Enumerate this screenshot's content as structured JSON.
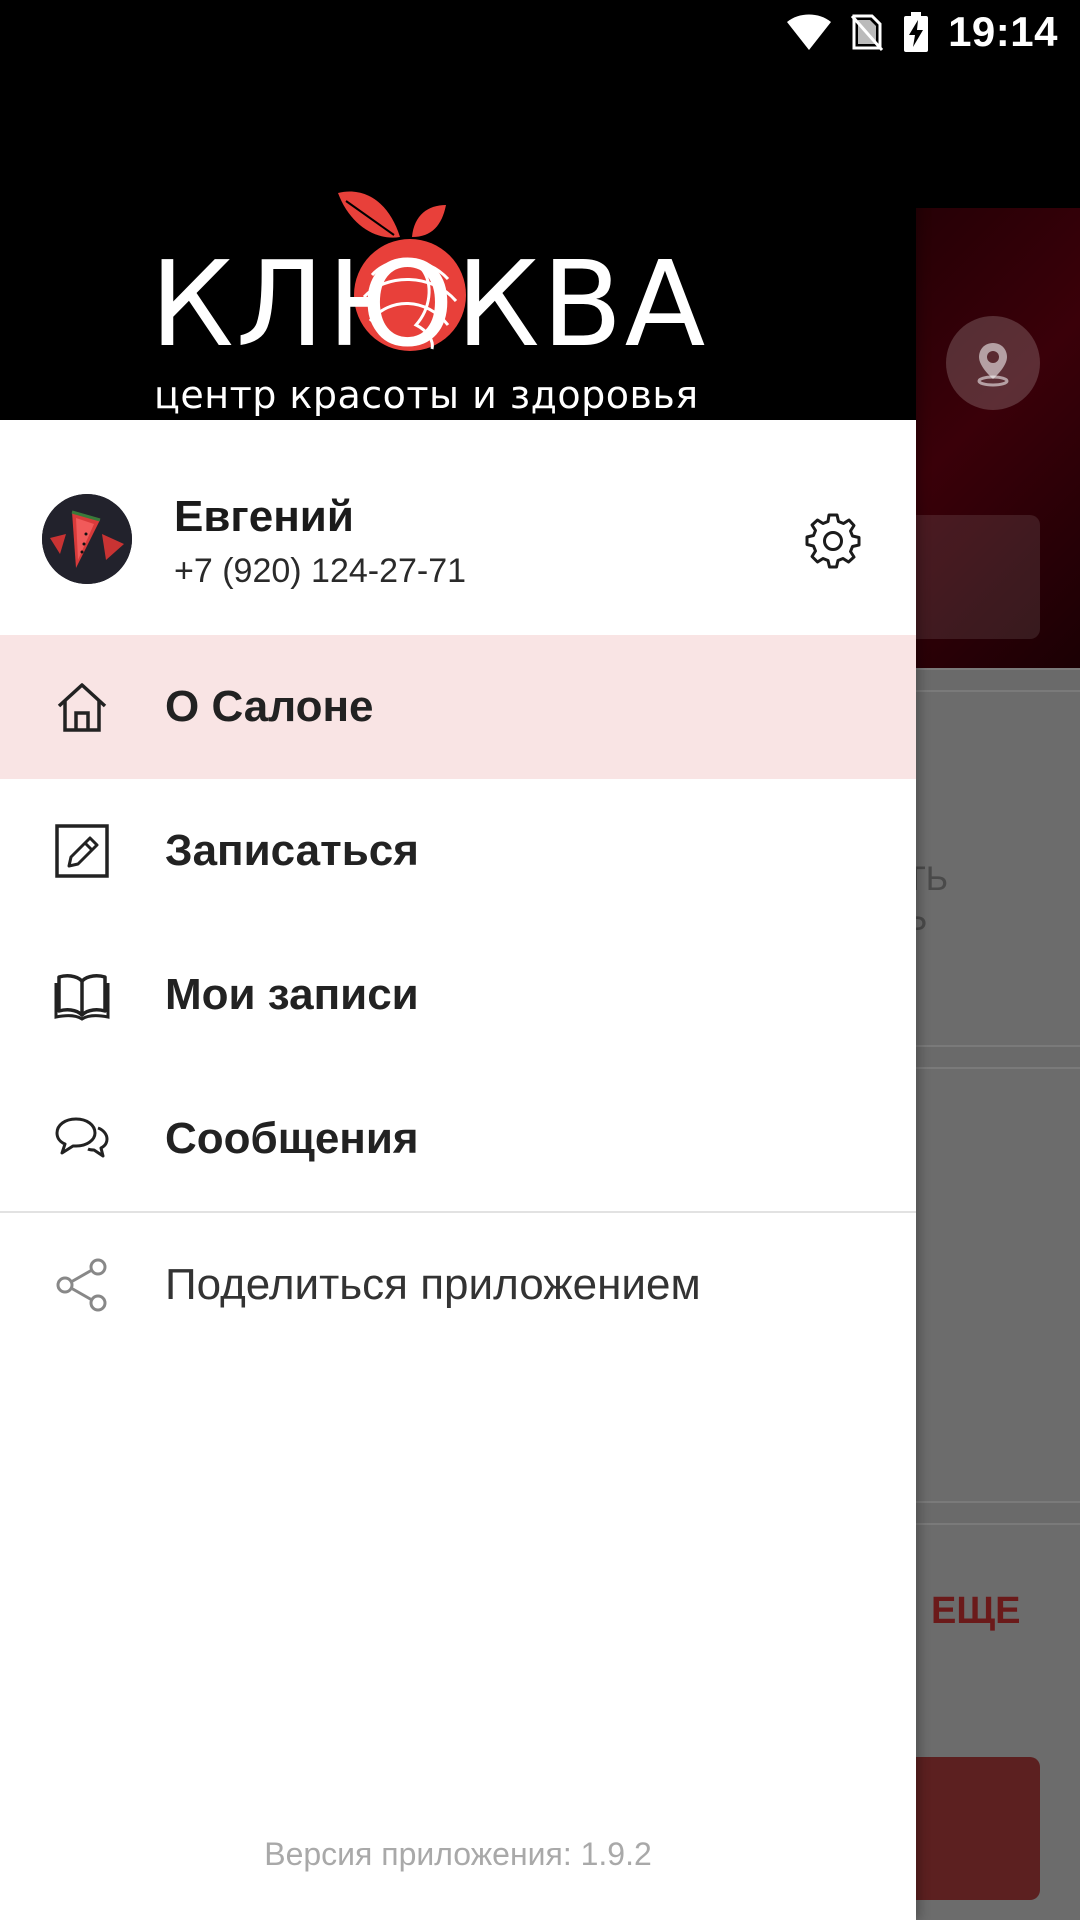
{
  "status_bar": {
    "time": "19:14",
    "icons": [
      "wifi-icon",
      "no-sim-icon",
      "battery-charging-icon"
    ]
  },
  "logo": {
    "wordmark": "КЛЮКВА",
    "tagline": "центр красоты и здоровья",
    "colors": {
      "brand_red": "#e8403a",
      "text": "#ffffff",
      "background": "#000000"
    }
  },
  "profile": {
    "name": "Евгений",
    "phone": "+7 (920) 124-27-71",
    "settings_icon": "gear-icon"
  },
  "menu": {
    "items": [
      {
        "label": "О Салоне",
        "icon": "home-icon",
        "active": true
      },
      {
        "label": "Записаться",
        "icon": "edit-icon",
        "active": false
      },
      {
        "label": "Мои записи",
        "icon": "book-icon",
        "active": false
      },
      {
        "label": "Сообщения",
        "icon": "chat-icon",
        "active": false
      }
    ],
    "secondary": [
      {
        "label": "Поделиться приложением",
        "icon": "share-icon"
      }
    ]
  },
  "footer": {
    "version": "Версия приложения: 1.9.2"
  },
  "background_app": {
    "partial_text_1": "ТЬ",
    "partial_text_2": "Ь",
    "more_button": "ЕЩЕ"
  },
  "colors": {
    "active_item_bg": "#f9e4e4",
    "scrim": "#6e6e6e",
    "accent_dark_red": "#6b1a1a"
  }
}
